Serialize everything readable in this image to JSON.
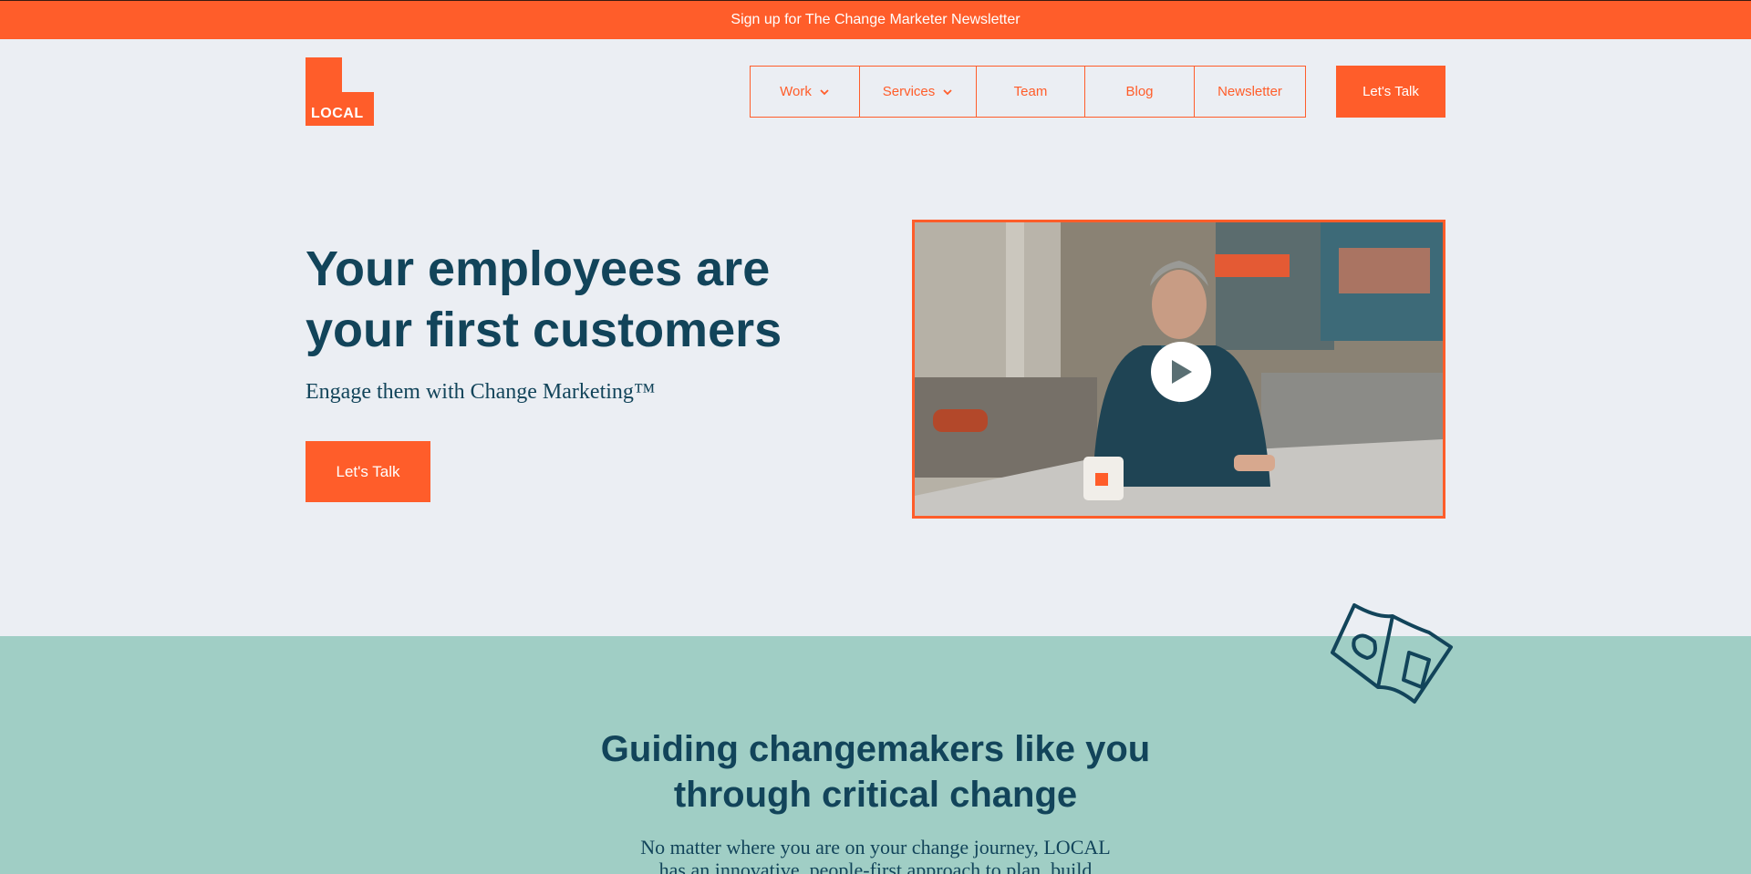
{
  "announcement": {
    "text": "Sign up for The Change Marketer Newsletter"
  },
  "logo": {
    "text": "LOCAL",
    "color": "#ff5d2a"
  },
  "nav": {
    "items": [
      {
        "label": "Work",
        "has_dropdown": true
      },
      {
        "label": "Services",
        "has_dropdown": true
      },
      {
        "label": "Team"
      },
      {
        "label": "Blog"
      },
      {
        "label": "Newsletter"
      }
    ],
    "cta_label": "Let's Talk"
  },
  "hero": {
    "title_line1": "Your employees are",
    "title_line2": "your first customers",
    "subtitle": "Engage them with Change Marketing™",
    "cta_label": "Let's Talk",
    "video": {
      "play_icon": "play-icon"
    }
  },
  "section2": {
    "icon": "map-icon",
    "title_line1": "Guiding changemakers like you",
    "title_line2": "through critical change",
    "body_line1": "No matter where you are on your change journey, LOCAL",
    "body_line2": "has an innovative, people-first approach to plan, build"
  },
  "colors": {
    "accent": "#ff5d2a",
    "navy": "#12445a",
    "background": "#ebeef3",
    "teal": "#a0cec5"
  }
}
